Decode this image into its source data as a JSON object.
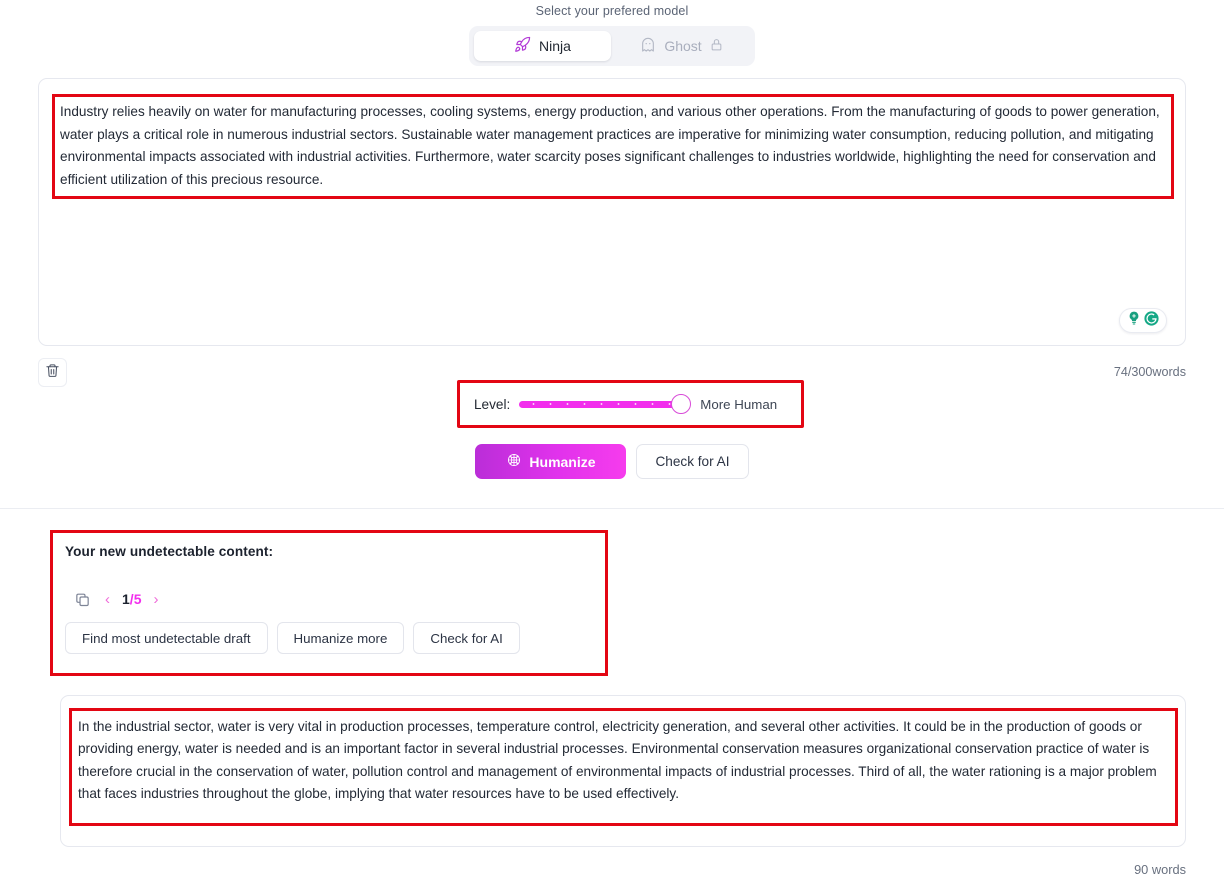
{
  "model_selector": {
    "heading": "Select your prefered model",
    "tabs": [
      {
        "label": "Ninja",
        "icon": "rocket-icon",
        "active": true,
        "locked": false
      },
      {
        "label": "Ghost",
        "icon": "ghost-icon",
        "active": false,
        "locked": true
      }
    ]
  },
  "input": {
    "text": "Industry relies heavily on water for manufacturing processes, cooling systems, energy production, and various other operations. From the manufacturing of goods to power generation, water plays a critical role in numerous industrial sectors. Sustainable water management practices are imperative for minimizing water consumption, reducing pollution, and mitigating environmental impacts associated with industrial activities. Furthermore, water scarcity poses significant challenges to industries worldwide, highlighting the need for conservation and efficient utilization of this precious resource.",
    "word_count": "74/300words",
    "trash_icon": "trash-icon",
    "grammarly": {
      "bulb_icon": "lightbulb-plus-icon",
      "logo_icon": "grammarly-g-icon",
      "accent": "#15c39a"
    }
  },
  "level": {
    "label": "Level:",
    "caption": "More Human",
    "value": 100,
    "min": 0,
    "max": 100,
    "track_color": "#f22ded",
    "thumb_border": "#d84bd8"
  },
  "actions": {
    "humanize_label": "Humanize",
    "humanize_icon": "brain-icon",
    "check_ai_label": "Check for AI",
    "gradient_from": "#ba2ed8",
    "gradient_to": "#f63ced"
  },
  "results": {
    "title": "Your new undetectable content:",
    "copy_icon": "copy-icon",
    "prev_icon": "chevron-left-icon",
    "next_icon": "chevron-right-icon",
    "page_current": "1",
    "page_separator": "/",
    "page_total": "5",
    "buttons": [
      "Find most undetectable draft",
      "Humanize more",
      "Check for AI"
    ]
  },
  "output": {
    "text": "In the industrial sector, water is very vital in production processes, temperature control, electricity generation, and several other activities. It could be in the production of goods or providing energy, water is needed and is an important factor in several industrial processes. Environmental conservation measures organizational conservation practice of water is therefore crucial in the conservation of water, pollution control and management of environmental impacts of industrial processes. Third of all, the water rationing is a major problem that faces industries throughout the globe, implying that water resources have to be used effectively.",
    "word_count": "90 words"
  },
  "annotation": {
    "box_color": "#e30613"
  }
}
